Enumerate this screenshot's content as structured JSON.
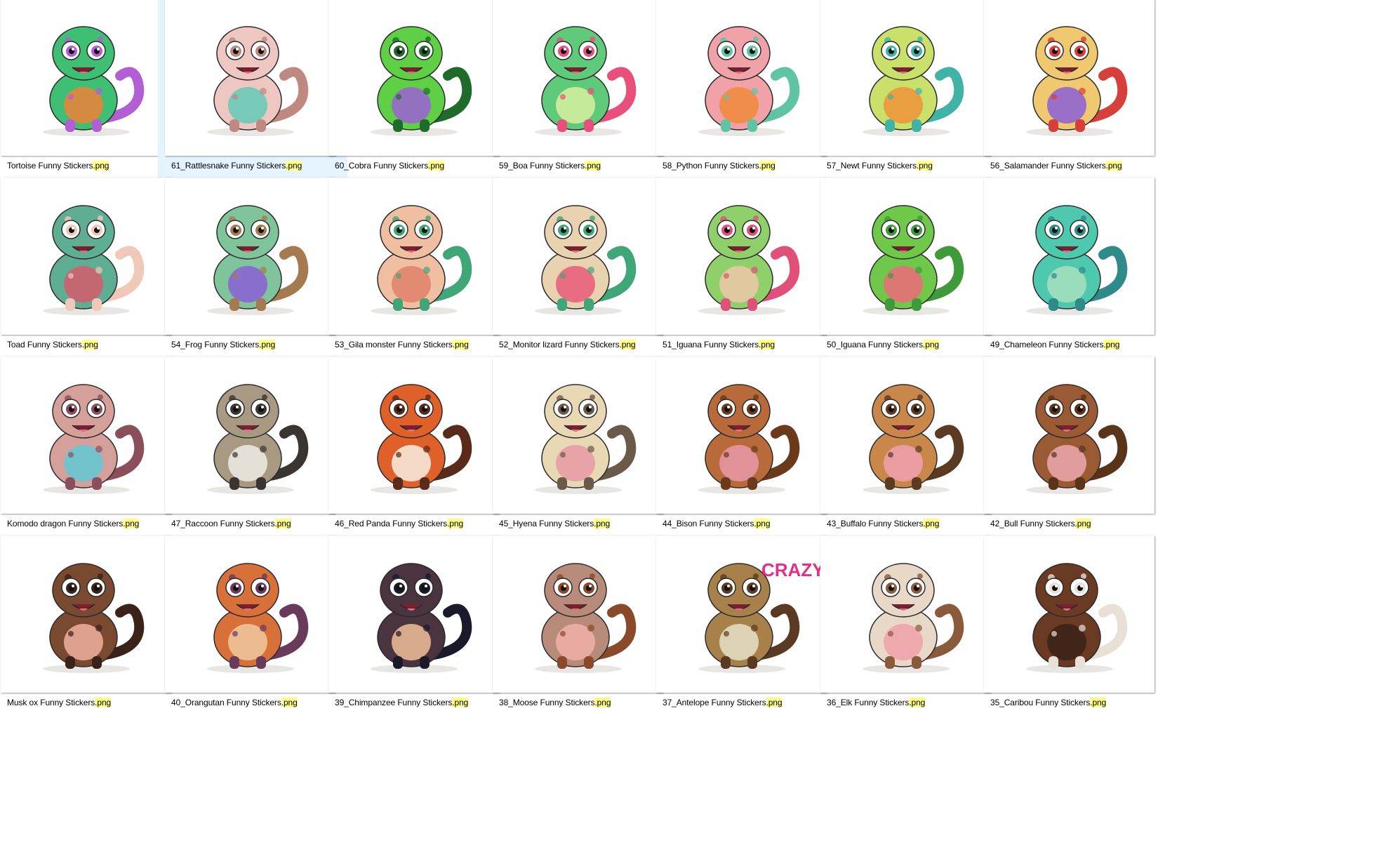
{
  "files": [
    {
      "name": "Tortoise Funny Stickers",
      "ext": ".png",
      "icon": "tortoise-icon",
      "colors": [
        "#3fbf74",
        "#b25fd6",
        "#f0803a"
      ]
    },
    {
      "name": "61_Rattlesnake Funny Stickers",
      "ext": ".png",
      "icon": "rattlesnake-icon",
      "colors": [
        "#efc7c2",
        "#bf8880",
        "#62c9b6"
      ],
      "selected": true
    },
    {
      "name": "60_Cobra Funny Stickers",
      "ext": ".png",
      "icon": "cobra-icon",
      "colors": [
        "#5fcf46",
        "#1e6b2a",
        "#9c5fd6"
      ]
    },
    {
      "name": "59_Boa Funny Stickers",
      "ext": ".png",
      "icon": "boa-icon",
      "colors": [
        "#5fca7a",
        "#e84f7a",
        "#d6f0a0"
      ]
    },
    {
      "name": "58_Python Funny Stickers",
      "ext": ".png",
      "icon": "python-icon",
      "colors": [
        "#f0a2a8",
        "#5fc4a4",
        "#f08a3a"
      ]
    },
    {
      "name": "57_Newt Funny Stickers",
      "ext": ".png",
      "icon": "newt-icon",
      "colors": [
        "#c9e06b",
        "#3fb4a6",
        "#f0903a"
      ]
    },
    {
      "name": "56_Salamander Funny Stickers",
      "ext": ".png",
      "icon": "salamander-icon",
      "colors": [
        "#f0c870",
        "#d63f3a",
        "#8a5fd6"
      ]
    },
    {
      "name": "Toad Funny Stickers",
      "ext": ".png",
      "icon": "toad-icon",
      "colors": [
        "#5fae94",
        "#f0c8b8",
        "#d65a6a"
      ]
    },
    {
      "name": "54_Frog Funny Stickers",
      "ext": ".png",
      "icon": "frog-icon",
      "colors": [
        "#7fc49a",
        "#a67a4f",
        "#8a5fd6"
      ]
    },
    {
      "name": "53_Gila monster Funny Stickers",
      "ext": ".png",
      "icon": "gila-monster-icon",
      "colors": [
        "#f0bfa2",
        "#3fa678",
        "#e0806a"
      ]
    },
    {
      "name": "52_Monitor lizard Funny Stickers",
      "ext": ".png",
      "icon": "monitor-lizard-icon",
      "colors": [
        "#e8d2b0",
        "#3fa678",
        "#e85a7a"
      ]
    },
    {
      "name": "51_Iguana Funny Stickers",
      "ext": ".png",
      "icon": "iguana-icon",
      "colors": [
        "#8fd06a",
        "#e0507a",
        "#f0c8a8"
      ]
    },
    {
      "name": "50_Iguana Funny Stickers",
      "ext": ".png",
      "icon": "iguana-icon",
      "colors": [
        "#6fc84a",
        "#3f9a3a",
        "#f06a7a"
      ]
    },
    {
      "name": "49_Chameleon Funny Stickers",
      "ext": ".png",
      "icon": "chameleon-icon",
      "colors": [
        "#4fc9ae",
        "#2f8a8a",
        "#a6e0c0"
      ]
    },
    {
      "name": "Komodo dragon Funny Stickers",
      "ext": ".png",
      "icon": "komodo-dragon-icon",
      "colors": [
        "#d6a09a",
        "#8a4f5a",
        "#62c9d6"
      ]
    },
    {
      "name": "47_Raccoon Funny Stickers",
      "ext": ".png",
      "icon": "raccoon-icon",
      "colors": [
        "#a89a82",
        "#3a3530",
        "#f0ece4"
      ]
    },
    {
      "name": "46_Red Panda Funny Stickers",
      "ext": ".png",
      "icon": "red-panda-icon",
      "colors": [
        "#e0602a",
        "#5a2a1a",
        "#f8f0e4"
      ]
    },
    {
      "name": "45_Hyena Funny Stickers",
      "ext": ".png",
      "icon": "hyena-icon",
      "colors": [
        "#e8d8b4",
        "#6a5a4a",
        "#e89aa6"
      ]
    },
    {
      "name": "44_Bison Funny Stickers",
      "ext": ".png",
      "icon": "bison-icon",
      "colors": [
        "#b86a3a",
        "#6a3a1a",
        "#e898a8"
      ]
    },
    {
      "name": "43_Buffalo Funny Stickers",
      "ext": ".png",
      "icon": "buffalo-icon",
      "colors": [
        "#c9884a",
        "#5a3a22",
        "#f0a0b0"
      ]
    },
    {
      "name": "42_Bull Funny Stickers",
      "ext": ".png",
      "icon": "bull-icon",
      "colors": [
        "#9a5a34",
        "#5a3418",
        "#f0a8b0"
      ]
    },
    {
      "name": "Musk ox Funny Stickers",
      "ext": ".png",
      "icon": "musk-ox-icon",
      "colors": [
        "#7a4a30",
        "#3a2218",
        "#f0b0a0"
      ]
    },
    {
      "name": "40_Orangutan Funny Stickers",
      "ext": ".png",
      "icon": "orangutan-icon",
      "colors": [
        "#d8703a",
        "#6a3a5a",
        "#f0c8a0"
      ]
    },
    {
      "name": "39_Chimpanzee Funny Stickers",
      "ext": ".png",
      "icon": "chimpanzee-icon",
      "colors": [
        "#4a3440",
        "#1a1a2a",
        "#f0c09a"
      ]
    },
    {
      "name": "38_Moose Funny Stickers",
      "ext": ".png",
      "icon": "moose-icon",
      "colors": [
        "#b88a7a",
        "#8a4a2a",
        "#f0b0a8"
      ]
    },
    {
      "name": "37_Antelope Funny Stickers",
      "ext": ".png",
      "icon": "antelope-icon",
      "colors": [
        "#a8804a",
        "#5a3a22",
        "#e8e0c8"
      ],
      "overlay_text": "CRAZY"
    },
    {
      "name": "36_Elk Funny Stickers",
      "ext": ".png",
      "icon": "elk-icon",
      "colors": [
        "#e8d8c8",
        "#8a5a3a",
        "#f0a0a8"
      ]
    },
    {
      "name": "35_Caribou Funny Stickers",
      "ext": ".png",
      "icon": "caribou-icon",
      "colors": [
        "#6a3a22",
        "#e8e0d4",
        "#3a2218"
      ]
    }
  ]
}
